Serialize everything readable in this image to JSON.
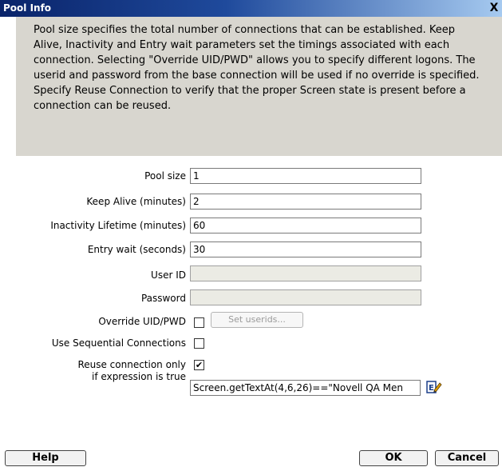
{
  "window": {
    "title": "Pool Info",
    "close_glyph": "X"
  },
  "info_text": "Pool size specifies the total number of connections that can be established.  Keep Alive, Inactivity and Entry wait parameters set the timings associated with each connection.  Selecting \"Override UID/PWD\" allows you to specify different logons. The userid and password from the base connection will be used if no override is specified. Specify Reuse Connection to verify that the proper Screen state is present before a connection can be reused.",
  "form": {
    "pool_size": {
      "label": "Pool size",
      "value": "1"
    },
    "keep_alive": {
      "label": "Keep Alive (minutes)",
      "value": "2"
    },
    "inactivity": {
      "label": "Inactivity Lifetime (minutes)",
      "value": "60"
    },
    "entry_wait": {
      "label": "Entry wait (seconds)",
      "value": "30"
    },
    "user_id": {
      "label": "User ID",
      "value": ""
    },
    "password": {
      "label": "Password",
      "value": ""
    },
    "override": {
      "label": "Override UID/PWD",
      "checked": false,
      "button_label": "Set userids..."
    },
    "sequential": {
      "label": "Use Sequential Connections",
      "checked": false
    },
    "reuse": {
      "label_line1": "Reuse connection only",
      "label_line2": "if expression is true",
      "checked": true,
      "check_glyph": "✔",
      "expression": "Screen.getTextAt(4,6,26)==\"Novell QA Men"
    }
  },
  "buttons": {
    "help": "Help",
    "ok": "OK",
    "cancel": "Cancel"
  },
  "icons": {
    "expression_editor": "edit-expression-icon"
  }
}
